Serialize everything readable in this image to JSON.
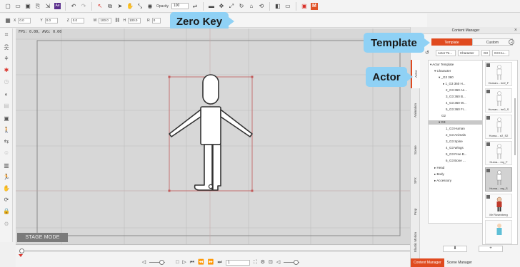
{
  "toolbar": {
    "opacity_label": "Opacity",
    "opacity_value": "100",
    "purple_icon_label": "Ae",
    "orange_icon_label": "M"
  },
  "transform_bar": {
    "x_label": "X",
    "x_value": "0.0",
    "y_label": "Y",
    "y_value": "0.0",
    "z_label": "Z",
    "z_value": "0.0",
    "w_label": "W",
    "w_value": "100.0",
    "h_label": "H",
    "h_value": "100.0",
    "r_label": "R",
    "r_value": "0",
    "zero_key_label": "Zero Key"
  },
  "viewport": {
    "fps_text": "FPS: 0.00, AVG: 0.00",
    "stage_mode_label": "STAGE MODE"
  },
  "playback": {
    "frame_value": "1"
  },
  "content_manager": {
    "title": "Content Manager",
    "tabs": [
      {
        "label": "Template",
        "active": true
      },
      {
        "label": "Custom",
        "active": false
      }
    ],
    "template_callout": "Template",
    "actor_callout": "Actor",
    "breadcrumb": [
      "Actor Te...",
      "Character",
      "G3",
      "G3 Hu..."
    ],
    "side_tabs": [
      "Actor",
      "Animation",
      "Scene",
      "SFX",
      "Prop",
      "Elastic Motion"
    ],
    "tree": [
      {
        "label": "Actor Template",
        "level": 0,
        "arrow": "▾"
      },
      {
        "label": "Character",
        "level": 1,
        "arrow": "▾"
      },
      {
        "label": "_G3 360",
        "level": 2,
        "arrow": "▾"
      },
      {
        "label": "1_G3 360 H...",
        "level": 3,
        "arrow": "▸"
      },
      {
        "label": "2_G3 360 An...",
        "level": 3,
        "arrow": ""
      },
      {
        "label": "3_G3 360 B...",
        "level": 3,
        "arrow": ""
      },
      {
        "label": "4_G3 360 W...",
        "level": 3,
        "arrow": ""
      },
      {
        "label": "5_G3 360 Fr...",
        "level": 3,
        "arrow": ""
      },
      {
        "label": "G2",
        "level": 2,
        "arrow": ""
      },
      {
        "label": "G3",
        "level": 2,
        "arrow": "▾",
        "selected": true
      },
      {
        "label": "1_G3 Human",
        "level": 3,
        "arrow": ""
      },
      {
        "label": "2_G3 Animals",
        "level": 3,
        "arrow": ""
      },
      {
        "label": "3_G3 Spine",
        "level": 3,
        "arrow": ""
      },
      {
        "label": "4_G3 Wings",
        "level": 3,
        "arrow": ""
      },
      {
        "label": "5_G3 Free B...",
        "level": 3,
        "arrow": ""
      },
      {
        "label": "6_G3 Bone ...",
        "level": 3,
        "arrow": ""
      },
      {
        "label": "Head",
        "level": 1,
        "arrow": "▸"
      },
      {
        "label": "Body",
        "level": 1,
        "arrow": "▸"
      },
      {
        "label": "Accessory",
        "level": 1,
        "arrow": "▸"
      }
    ],
    "thumbnails": [
      {
        "caption": "Human... ire2_F",
        "selected": false
      },
      {
        "caption": "Human... ire2_S",
        "selected": false
      },
      {
        "caption": "Huma... e2_S2",
        "selected": false
      },
      {
        "caption": "Huma... my_F",
        "selected": false
      },
      {
        "caption": "Huma... my_S",
        "selected": true
      },
      {
        "caption": "Mr Rosenberg",
        "selected": false
      },
      {
        "caption": "",
        "selected": false
      }
    ],
    "actions": [
      "⬇",
      "+"
    ],
    "bottom_tabs": [
      {
        "label": "Content Manager",
        "active": true
      },
      {
        "label": "Scene Manager",
        "active": false
      }
    ]
  },
  "colors": {
    "accent": "#e04a1f",
    "callout": "#8fd1f5",
    "viewport_bg": "#d7d7d7"
  }
}
